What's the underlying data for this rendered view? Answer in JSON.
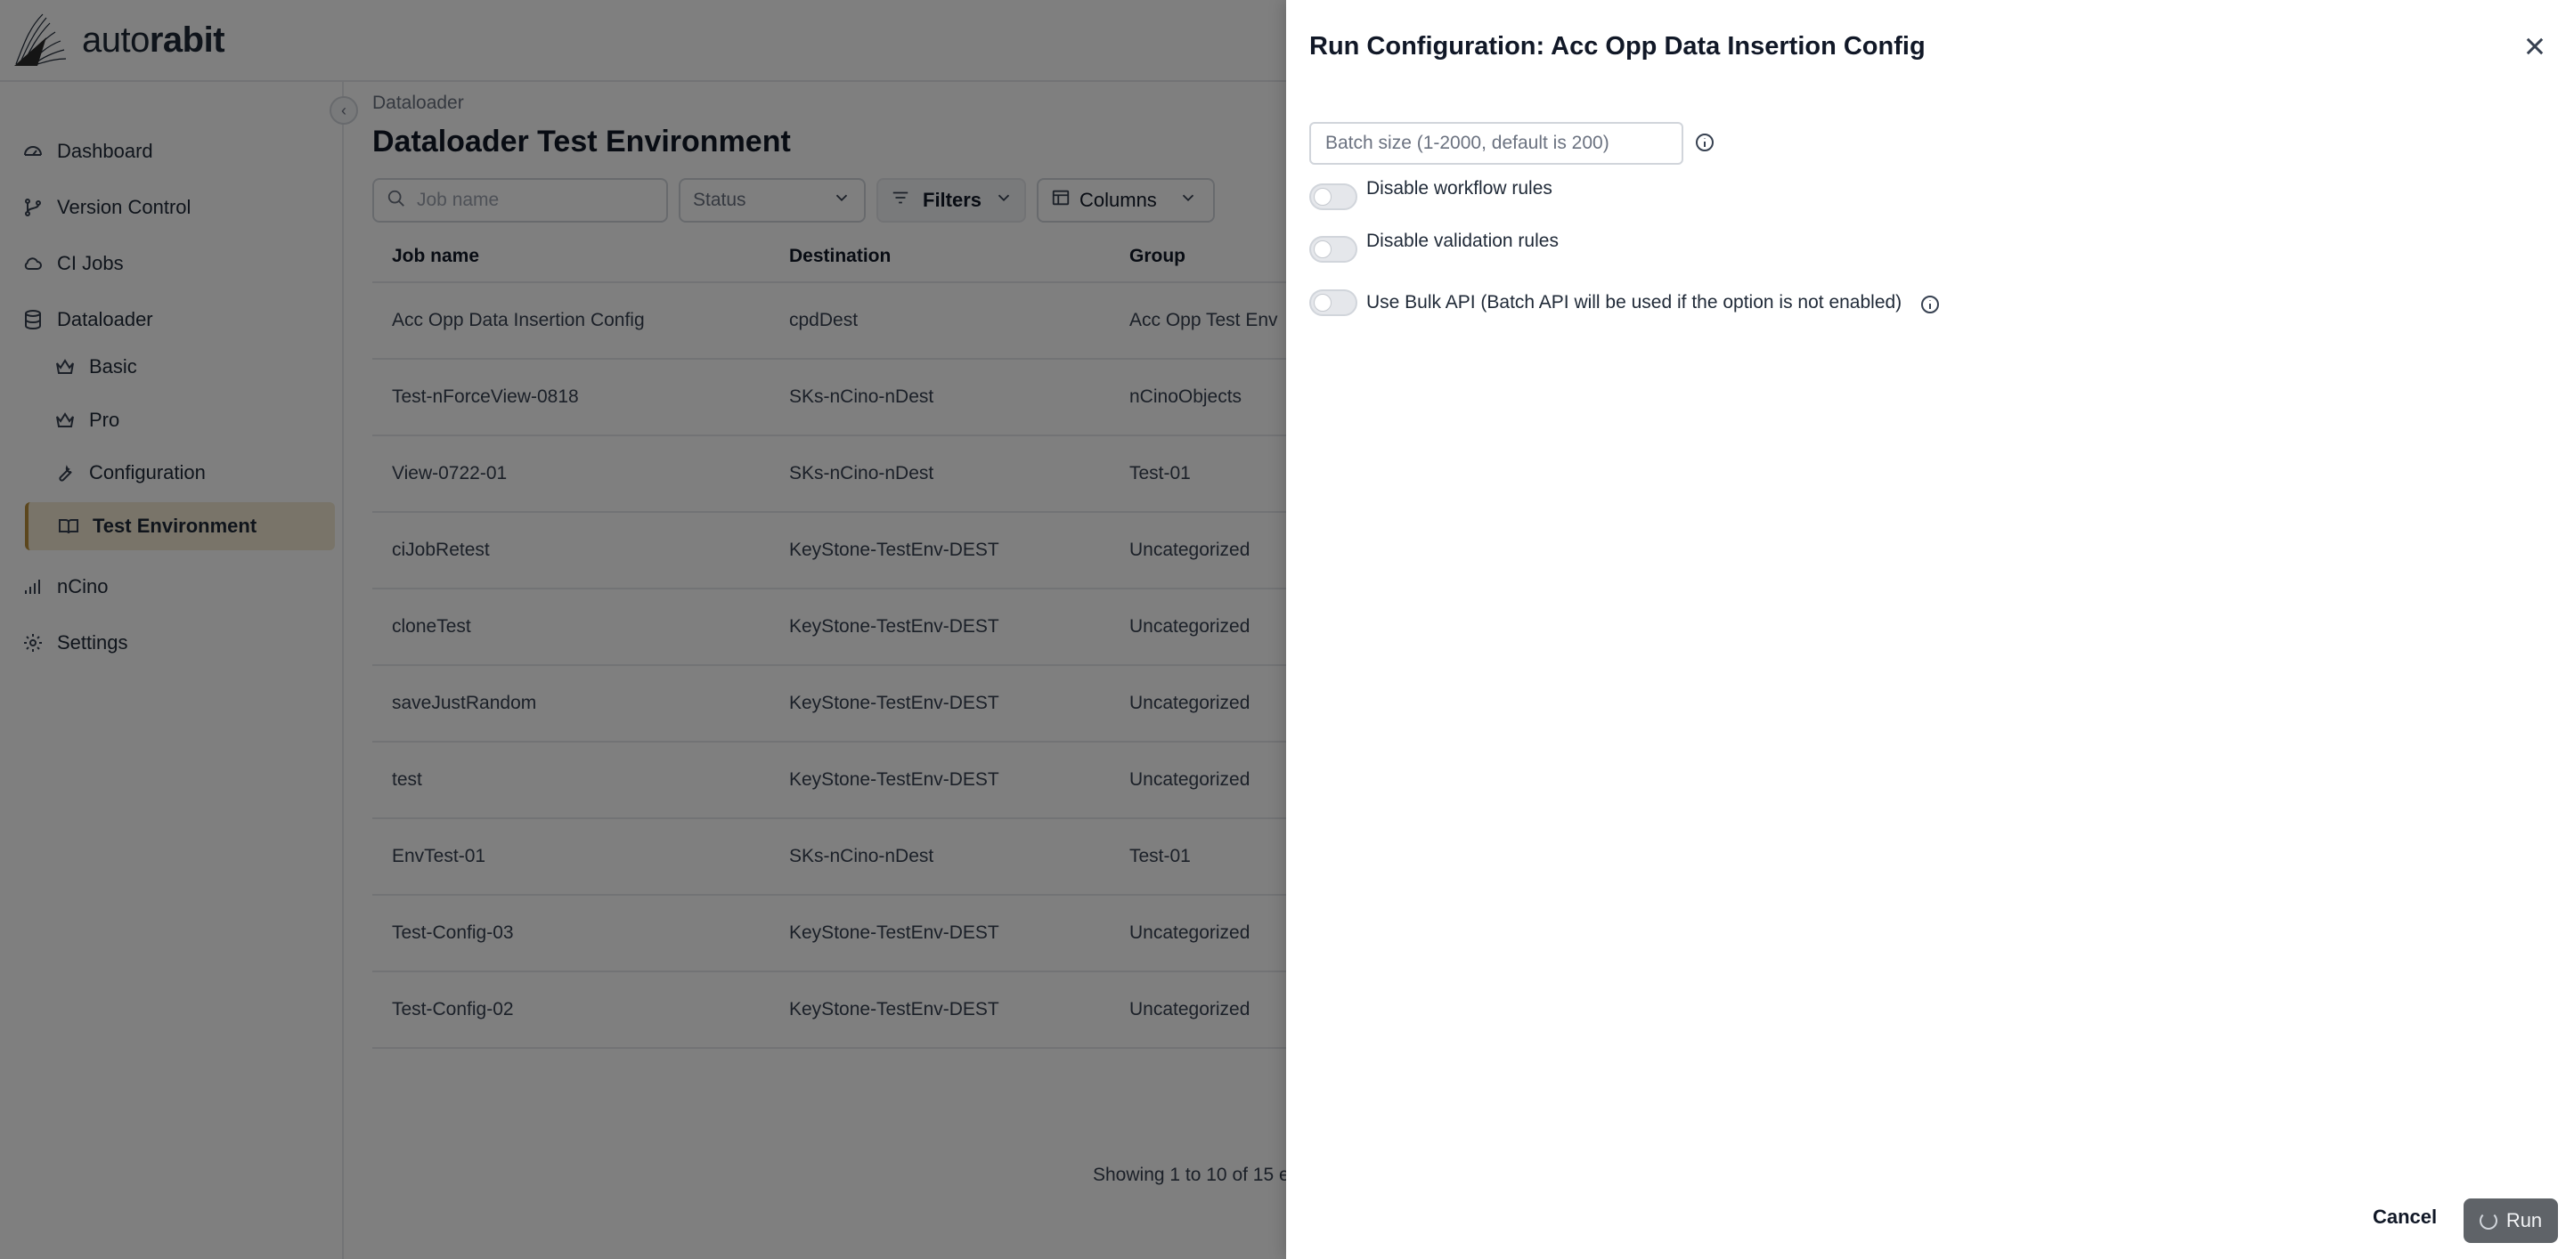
{
  "brand": {
    "logo_text_light": "auto",
    "logo_text_bold": "rabit"
  },
  "sidebar": {
    "items": [
      {
        "label": "Dashboard",
        "icon": "gauge-icon"
      },
      {
        "label": "Version Control",
        "icon": "git-branch-icon"
      },
      {
        "label": "CI Jobs",
        "icon": "cloud-icon"
      },
      {
        "label": "Dataloader",
        "icon": "database-icon"
      },
      {
        "label": "Basic",
        "icon": "crown-icon"
      },
      {
        "label": "Pro",
        "icon": "crown-icon"
      },
      {
        "label": "Configuration",
        "icon": "wrench-icon"
      },
      {
        "label": "Test Environment",
        "icon": "book-icon",
        "active": true
      },
      {
        "label": "nCino",
        "icon": "signal-bars-icon"
      },
      {
        "label": "Settings",
        "icon": "gear-icon"
      }
    ]
  },
  "main": {
    "breadcrumb": "Dataloader",
    "title": "Dataloader Test Environment",
    "search_placeholder": "Job name",
    "status_placeholder": "Status",
    "filters_label": "Filters",
    "columns_label": "Columns",
    "table": {
      "headers": [
        "Job name",
        "Destination",
        "Group"
      ],
      "rows": [
        [
          "Acc Opp Data Insertion Config",
          "cpdDest",
          "Acc Opp Test Env"
        ],
        [
          "Test-nForceView-0818",
          "SKs-nCino-nDest",
          "nCinoObjects"
        ],
        [
          "View-0722-01",
          "SKs-nCino-nDest",
          "Test-01"
        ],
        [
          "ciJobRetest",
          "KeyStone-TestEnv-DEST",
          "Uncategorized"
        ],
        [
          "cloneTest",
          "KeyStone-TestEnv-DEST",
          "Uncategorized"
        ],
        [
          "saveJustRandom",
          "KeyStone-TestEnv-DEST",
          "Uncategorized"
        ],
        [
          "test",
          "KeyStone-TestEnv-DEST",
          "Uncategorized"
        ],
        [
          "EnvTest-01",
          "SKs-nCino-nDest",
          "Test-01"
        ],
        [
          "Test-Config-03",
          "KeyStone-TestEnv-DEST",
          "Uncategorized"
        ],
        [
          "Test-Config-02",
          "KeyStone-TestEnv-DEST",
          "Uncategorized"
        ]
      ]
    },
    "pagination_text": "Showing 1 to 10 of 15 e"
  },
  "drawer": {
    "title": "Run Configuration: Acc Opp Data Insertion Config",
    "batch_size_placeholder": "Batch size (1-2000, default is 200)",
    "batch_size_value": "",
    "toggles": [
      {
        "label": "Disable workflow rules",
        "enabled": false
      },
      {
        "label": "Disable validation rules",
        "enabled": false
      },
      {
        "label": "Use Bulk API (Batch API will be used if the option is not enabled)",
        "enabled": false
      }
    ],
    "cancel_label": "Cancel",
    "run_label": "Run"
  },
  "colors": {
    "accent_active_bg": "#f3e9d2",
    "accent_active_border": "#b98f3c",
    "run_button": "#5f6368"
  }
}
